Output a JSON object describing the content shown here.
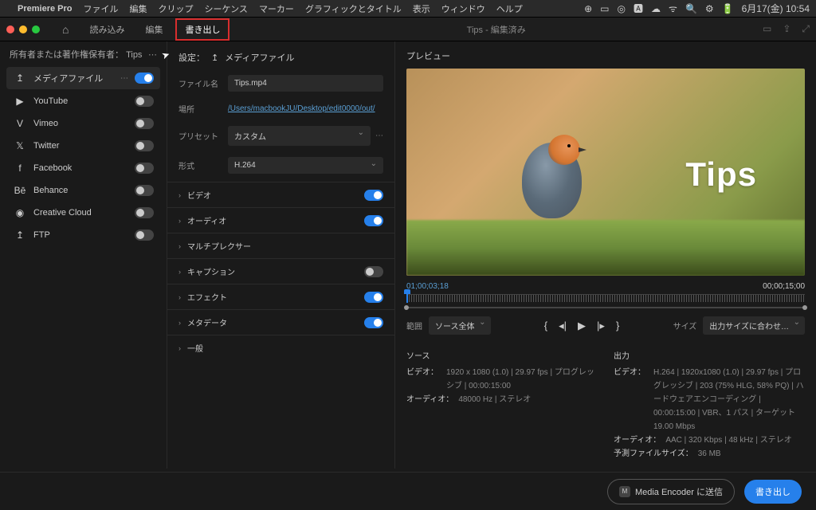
{
  "menubar": {
    "app": "Premiere Pro",
    "items": [
      "ファイル",
      "編集",
      "クリップ",
      "シーケンス",
      "マーカー",
      "グラフィックとタイトル",
      "表示",
      "ウィンドウ",
      "ヘルプ"
    ],
    "clock": "6月17(金) 10:54"
  },
  "topbar": {
    "tabs": {
      "import": "読み込み",
      "edit": "編集",
      "export": "書き出し"
    },
    "doc": "Tips - 編集済み"
  },
  "sidebar": {
    "header": "所有者または著作権保有者：",
    "owner": "Tips",
    "items": [
      {
        "icon": "↥",
        "label": "メディアファイル",
        "active": true,
        "dots": true,
        "on": true
      },
      {
        "icon": "▶",
        "label": "YouTube",
        "on": false
      },
      {
        "icon": "V",
        "label": "Vimeo",
        "on": false
      },
      {
        "icon": "𝕏",
        "label": "Twitter",
        "on": false
      },
      {
        "icon": "f",
        "label": "Facebook",
        "on": false
      },
      {
        "icon": "Bē",
        "label": "Behance",
        "on": false
      },
      {
        "icon": "◉",
        "label": "Creative Cloud",
        "on": false
      },
      {
        "icon": "↥",
        "label": "FTP",
        "on": false
      }
    ]
  },
  "settings": {
    "header": "設定：",
    "header_sub": "メディアファイル",
    "filename_label": "ファイル名",
    "filename": "Tips.mp4",
    "location_label": "場所",
    "location": "/Users/macbookJU/Desktop/edit0000/out/",
    "preset_label": "プリセット",
    "preset": "カスタム",
    "format_label": "形式",
    "format": "H.264",
    "sections": [
      {
        "label": "ビデオ",
        "toggle": true,
        "on": true
      },
      {
        "label": "オーディオ",
        "toggle": true,
        "on": true
      },
      {
        "label": "マルチプレクサー",
        "toggle": false
      },
      {
        "label": "キャプション",
        "toggle": true,
        "on": false
      },
      {
        "label": "エフェクト",
        "toggle": true,
        "on": true
      },
      {
        "label": "メタデータ",
        "toggle": true,
        "on": true
      },
      {
        "label": "一般",
        "toggle": false
      }
    ]
  },
  "preview": {
    "title": "プレビュー",
    "overlay": "Tips",
    "tc_current": "01;00;03;18",
    "tc_duration": "00;00;15;00",
    "range_label": "範囲",
    "range_value": "ソース全体",
    "size_label": "サイズ",
    "size_value": "出力サイズに合わせ…"
  },
  "info": {
    "source": {
      "title": "ソース",
      "video_label": "ビデオ：",
      "video": "1920 x 1080 (1.0) | 29.97 fps | プログレッシブ | 00:00:15:00",
      "audio_label": "オーディオ：",
      "audio": "48000 Hz | ステレオ"
    },
    "output": {
      "title": "出力",
      "v1_label": "ビデオ：",
      "v1": "H.264 | 1920x1080 (1.0) | 29.97 fps | プログレッシブ | 203 (75% HLG, 58% PQ) | ハードウェアエンコーディング | 00:00:15:00 | VBR、1 パス | ターゲット 19.00 Mbps",
      "a_label": "オーディオ：",
      "a": "AAC | 320 Kbps | 48 kHz | ステレオ",
      "size_label": "予測ファイルサイズ：",
      "size": "36 MB"
    }
  },
  "footer": {
    "encoder": "Media Encoder に送信",
    "export": "書き出し"
  }
}
